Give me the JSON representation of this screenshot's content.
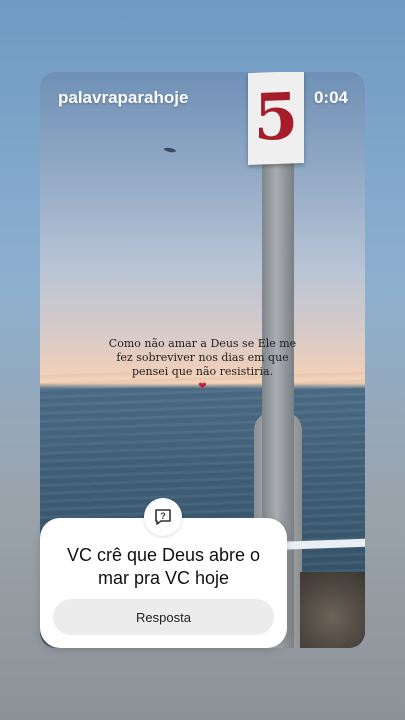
{
  "story": {
    "username": "palavraparahoje",
    "timestamp": "0:04",
    "sign_number": "5",
    "caption_line1": "Como não amar a Deus se Ele me",
    "caption_line2": "fez sobreviver nos dias em que",
    "caption_line3": "pensei que não resistiria.",
    "caption_emoji": "❤"
  },
  "sticker": {
    "icon": "question-message-icon",
    "question_line1": "VC crê que Deus abre o",
    "question_line2": "mar pra VC hoje",
    "reply_label": "Resposta"
  },
  "colors": {
    "heart": "#c2203a",
    "sign_number": "#a61c2a",
    "sticker_bg": "#ffffff",
    "reply_bg": "#ececec"
  }
}
